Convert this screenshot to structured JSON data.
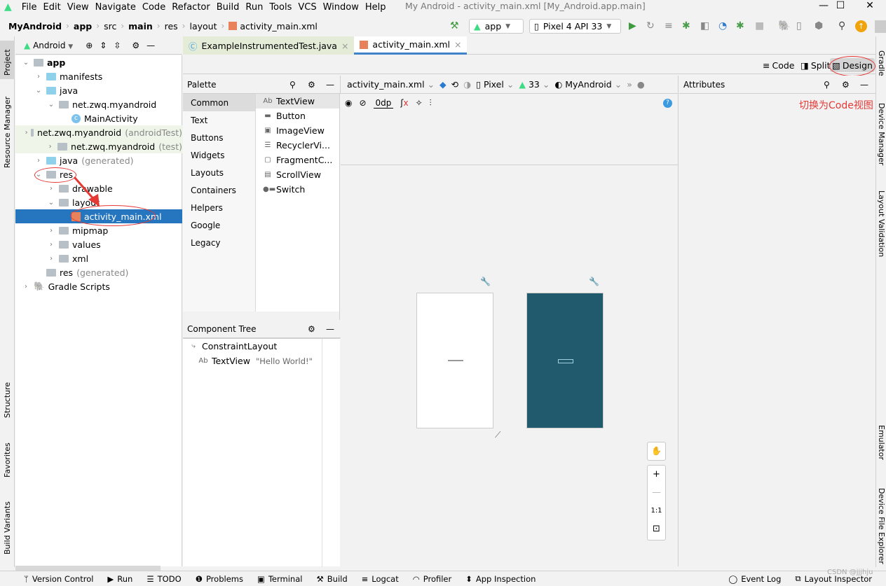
{
  "menu": [
    "File",
    "Edit",
    "View",
    "Navigate",
    "Code",
    "Refactor",
    "Build",
    "Run",
    "Tools",
    "VCS",
    "Window",
    "Help"
  ],
  "window_title": "My Android - activity_main.xml [My_Android.app.main]",
  "breadcrumb": [
    "MyAndroid",
    "app",
    "src",
    "main",
    "res",
    "layout",
    "activity_main.xml"
  ],
  "run_config": "app",
  "device": "Pixel 4 API 33",
  "left_stripe": [
    "Project",
    "Resource Manager",
    "Structure",
    "Favorites",
    "Build Variants"
  ],
  "right_stripe": [
    "Gradle",
    "Device Manager",
    "Layout Validation",
    "Emulator",
    "Device File Explorer"
  ],
  "project": {
    "view": "Android",
    "tree": [
      {
        "label": "app",
        "depth": 0,
        "expanded": true,
        "bold": true
      },
      {
        "label": "manifests",
        "depth": 1,
        "expanded": false
      },
      {
        "label": "java",
        "depth": 1,
        "expanded": true
      },
      {
        "label": "net.zwq.myandroid",
        "depth": 2,
        "expanded": true
      },
      {
        "label": "MainActivity",
        "depth": 3,
        "leaf": true
      },
      {
        "label": "net.zwq.myandroid",
        "suffix": "(androidTest)",
        "depth": 2,
        "expanded": false
      },
      {
        "label": "net.zwq.myandroid",
        "suffix": "(test)",
        "depth": 2,
        "expanded": false
      },
      {
        "label": "java",
        "suffix": "(generated)",
        "depth": 1,
        "expanded": false
      },
      {
        "label": "res",
        "depth": 1,
        "expanded": true
      },
      {
        "label": "drawable",
        "depth": 2,
        "expanded": false
      },
      {
        "label": "layout",
        "depth": 2,
        "expanded": true
      },
      {
        "label": "activity_main.xml",
        "depth": 3,
        "leaf": true,
        "selected": true
      },
      {
        "label": "mipmap",
        "depth": 2,
        "expanded": false
      },
      {
        "label": "values",
        "depth": 2,
        "expanded": false
      },
      {
        "label": "xml",
        "depth": 2,
        "expanded": false
      },
      {
        "label": "res",
        "suffix": "(generated)",
        "depth": 1,
        "leaf": true
      },
      {
        "label": "Gradle Scripts",
        "depth": 0,
        "expanded": false
      }
    ]
  },
  "tabs": [
    {
      "label": "ExampleInstrumentedTest.java",
      "active": false
    },
    {
      "label": "activity_main.xml",
      "active": true
    }
  ],
  "modes": {
    "code": "Code",
    "split": "Split",
    "design": "Design",
    "active": "Design"
  },
  "palette": {
    "title": "Palette",
    "categories": [
      "Common",
      "Text",
      "Buttons",
      "Widgets",
      "Layouts",
      "Containers",
      "Helpers",
      "Google",
      "Legacy"
    ],
    "items": [
      {
        "icon": "Ab",
        "label": "TextView"
      },
      {
        "icon": "▬",
        "label": "Button"
      },
      {
        "icon": "▣",
        "label": "ImageView"
      },
      {
        "icon": "☰",
        "label": "RecyclerVi..."
      },
      {
        "icon": "▢",
        "label": "FragmentC..."
      },
      {
        "icon": "▤",
        "label": "ScrollView"
      },
      {
        "icon": "●▬",
        "label": "Switch"
      }
    ]
  },
  "component_tree": {
    "title": "Component Tree",
    "root": "ConstraintLayout",
    "child": {
      "icon": "Ab",
      "label": "TextView",
      "value": "\"Hello World!\""
    }
  },
  "design_toolbar": {
    "file": "activity_main.xml",
    "device": "Pixel",
    "api": "33",
    "theme": "MyAndroid",
    "margin": "0dp"
  },
  "attributes": {
    "title": "Attributes"
  },
  "annotation": "切换为Code视图",
  "zoom": {
    "fit": "1:1"
  },
  "bottom": [
    "Version Control",
    "Run",
    "TODO",
    "Problems",
    "Terminal",
    "Build",
    "Logcat",
    "Profiler",
    "App Inspection"
  ],
  "bottom_right": [
    "Event Log",
    "Layout Inspector"
  ],
  "watermark": "CSDN @jjjhju",
  "colors": {
    "selection": "#2675bf",
    "blueprint": "#215a6d",
    "annotation": "#e53935",
    "android": "#3ddc84"
  }
}
